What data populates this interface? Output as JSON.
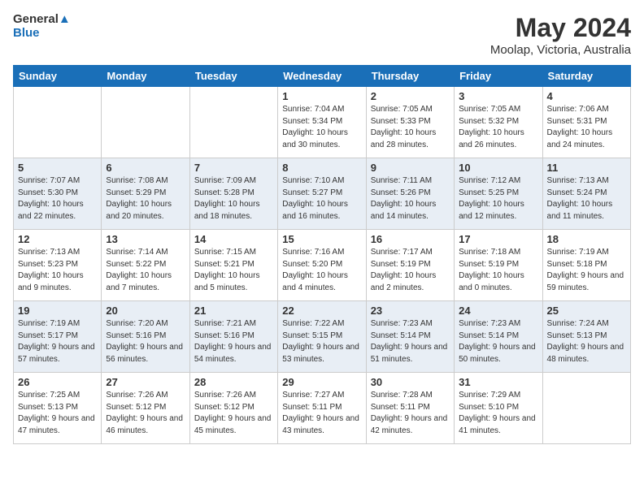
{
  "header": {
    "logo_line1": "General",
    "logo_line2": "Blue",
    "title": "May 2024",
    "subtitle": "Moolap, Victoria, Australia"
  },
  "days_of_week": [
    "Sunday",
    "Monday",
    "Tuesday",
    "Wednesday",
    "Thursday",
    "Friday",
    "Saturday"
  ],
  "weeks": [
    [
      {
        "day": "",
        "sunrise": "",
        "sunset": "",
        "daylight": ""
      },
      {
        "day": "",
        "sunrise": "",
        "sunset": "",
        "daylight": ""
      },
      {
        "day": "",
        "sunrise": "",
        "sunset": "",
        "daylight": ""
      },
      {
        "day": "1",
        "sunrise": "Sunrise: 7:04 AM",
        "sunset": "Sunset: 5:34 PM",
        "daylight": "Daylight: 10 hours and 30 minutes."
      },
      {
        "day": "2",
        "sunrise": "Sunrise: 7:05 AM",
        "sunset": "Sunset: 5:33 PM",
        "daylight": "Daylight: 10 hours and 28 minutes."
      },
      {
        "day": "3",
        "sunrise": "Sunrise: 7:05 AM",
        "sunset": "Sunset: 5:32 PM",
        "daylight": "Daylight: 10 hours and 26 minutes."
      },
      {
        "day": "4",
        "sunrise": "Sunrise: 7:06 AM",
        "sunset": "Sunset: 5:31 PM",
        "daylight": "Daylight: 10 hours and 24 minutes."
      }
    ],
    [
      {
        "day": "5",
        "sunrise": "Sunrise: 7:07 AM",
        "sunset": "Sunset: 5:30 PM",
        "daylight": "Daylight: 10 hours and 22 minutes."
      },
      {
        "day": "6",
        "sunrise": "Sunrise: 7:08 AM",
        "sunset": "Sunset: 5:29 PM",
        "daylight": "Daylight: 10 hours and 20 minutes."
      },
      {
        "day": "7",
        "sunrise": "Sunrise: 7:09 AM",
        "sunset": "Sunset: 5:28 PM",
        "daylight": "Daylight: 10 hours and 18 minutes."
      },
      {
        "day": "8",
        "sunrise": "Sunrise: 7:10 AM",
        "sunset": "Sunset: 5:27 PM",
        "daylight": "Daylight: 10 hours and 16 minutes."
      },
      {
        "day": "9",
        "sunrise": "Sunrise: 7:11 AM",
        "sunset": "Sunset: 5:26 PM",
        "daylight": "Daylight: 10 hours and 14 minutes."
      },
      {
        "day": "10",
        "sunrise": "Sunrise: 7:12 AM",
        "sunset": "Sunset: 5:25 PM",
        "daylight": "Daylight: 10 hours and 12 minutes."
      },
      {
        "day": "11",
        "sunrise": "Sunrise: 7:13 AM",
        "sunset": "Sunset: 5:24 PM",
        "daylight": "Daylight: 10 hours and 11 minutes."
      }
    ],
    [
      {
        "day": "12",
        "sunrise": "Sunrise: 7:13 AM",
        "sunset": "Sunset: 5:23 PM",
        "daylight": "Daylight: 10 hours and 9 minutes."
      },
      {
        "day": "13",
        "sunrise": "Sunrise: 7:14 AM",
        "sunset": "Sunset: 5:22 PM",
        "daylight": "Daylight: 10 hours and 7 minutes."
      },
      {
        "day": "14",
        "sunrise": "Sunrise: 7:15 AM",
        "sunset": "Sunset: 5:21 PM",
        "daylight": "Daylight: 10 hours and 5 minutes."
      },
      {
        "day": "15",
        "sunrise": "Sunrise: 7:16 AM",
        "sunset": "Sunset: 5:20 PM",
        "daylight": "Daylight: 10 hours and 4 minutes."
      },
      {
        "day": "16",
        "sunrise": "Sunrise: 7:17 AM",
        "sunset": "Sunset: 5:19 PM",
        "daylight": "Daylight: 10 hours and 2 minutes."
      },
      {
        "day": "17",
        "sunrise": "Sunrise: 7:18 AM",
        "sunset": "Sunset: 5:19 PM",
        "daylight": "Daylight: 10 hours and 0 minutes."
      },
      {
        "day": "18",
        "sunrise": "Sunrise: 7:19 AM",
        "sunset": "Sunset: 5:18 PM",
        "daylight": "Daylight: 9 hours and 59 minutes."
      }
    ],
    [
      {
        "day": "19",
        "sunrise": "Sunrise: 7:19 AM",
        "sunset": "Sunset: 5:17 PM",
        "daylight": "Daylight: 9 hours and 57 minutes."
      },
      {
        "day": "20",
        "sunrise": "Sunrise: 7:20 AM",
        "sunset": "Sunset: 5:16 PM",
        "daylight": "Daylight: 9 hours and 56 minutes."
      },
      {
        "day": "21",
        "sunrise": "Sunrise: 7:21 AM",
        "sunset": "Sunset: 5:16 PM",
        "daylight": "Daylight: 9 hours and 54 minutes."
      },
      {
        "day": "22",
        "sunrise": "Sunrise: 7:22 AM",
        "sunset": "Sunset: 5:15 PM",
        "daylight": "Daylight: 9 hours and 53 minutes."
      },
      {
        "day": "23",
        "sunrise": "Sunrise: 7:23 AM",
        "sunset": "Sunset: 5:14 PM",
        "daylight": "Daylight: 9 hours and 51 minutes."
      },
      {
        "day": "24",
        "sunrise": "Sunrise: 7:23 AM",
        "sunset": "Sunset: 5:14 PM",
        "daylight": "Daylight: 9 hours and 50 minutes."
      },
      {
        "day": "25",
        "sunrise": "Sunrise: 7:24 AM",
        "sunset": "Sunset: 5:13 PM",
        "daylight": "Daylight: 9 hours and 48 minutes."
      }
    ],
    [
      {
        "day": "26",
        "sunrise": "Sunrise: 7:25 AM",
        "sunset": "Sunset: 5:13 PM",
        "daylight": "Daylight: 9 hours and 47 minutes."
      },
      {
        "day": "27",
        "sunrise": "Sunrise: 7:26 AM",
        "sunset": "Sunset: 5:12 PM",
        "daylight": "Daylight: 9 hours and 46 minutes."
      },
      {
        "day": "28",
        "sunrise": "Sunrise: 7:26 AM",
        "sunset": "Sunset: 5:12 PM",
        "daylight": "Daylight: 9 hours and 45 minutes."
      },
      {
        "day": "29",
        "sunrise": "Sunrise: 7:27 AM",
        "sunset": "Sunset: 5:11 PM",
        "daylight": "Daylight: 9 hours and 43 minutes."
      },
      {
        "day": "30",
        "sunrise": "Sunrise: 7:28 AM",
        "sunset": "Sunset: 5:11 PM",
        "daylight": "Daylight: 9 hours and 42 minutes."
      },
      {
        "day": "31",
        "sunrise": "Sunrise: 7:29 AM",
        "sunset": "Sunset: 5:10 PM",
        "daylight": "Daylight: 9 hours and 41 minutes."
      },
      {
        "day": "",
        "sunrise": "",
        "sunset": "",
        "daylight": ""
      }
    ]
  ]
}
